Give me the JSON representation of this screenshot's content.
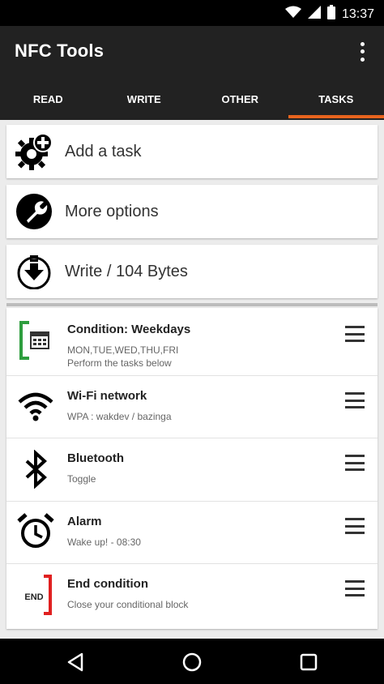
{
  "status_bar": {
    "time": "13:37",
    "icons": [
      "wifi-icon",
      "signal-icon",
      "battery-icon"
    ]
  },
  "app_bar": {
    "title": "NFC Tools",
    "menu_icon": "overflow-menu-icon"
  },
  "tabs": [
    {
      "label": "READ",
      "active": false
    },
    {
      "label": "WRITE",
      "active": false
    },
    {
      "label": "OTHER",
      "active": false
    },
    {
      "label": "TASKS",
      "active": true
    }
  ],
  "actions": [
    {
      "label": "Add a task",
      "icon": "add-task-gear-icon"
    },
    {
      "label": "More options",
      "icon": "wrench-icon"
    },
    {
      "label": "Write / 104 Bytes",
      "icon": "write-download-icon"
    }
  ],
  "tasks": [
    {
      "title": "Condition: Weekdays",
      "line1": "MON,TUE,WED,THU,FRI",
      "line2": "Perform the tasks below",
      "icon": "calendar-condition-icon"
    },
    {
      "title": "Wi-Fi network",
      "line1": "WPA : wakdev / bazinga",
      "icon": "wifi-icon"
    },
    {
      "title": "Bluetooth",
      "line1": "Toggle",
      "icon": "bluetooth-icon"
    },
    {
      "title": "Alarm",
      "line1": "Wake up! - 08:30",
      "icon": "alarm-clock-icon"
    },
    {
      "title": "End condition",
      "line1": "Close your conditional block",
      "icon": "end-condition-icon",
      "icon_text": "END"
    }
  ],
  "colors": {
    "accent": "#e8641e",
    "app_bar": "#222222",
    "condition_green": "#2e9e3e",
    "end_red": "#e02020"
  },
  "nav": [
    "back-icon",
    "home-icon",
    "recents-icon"
  ]
}
